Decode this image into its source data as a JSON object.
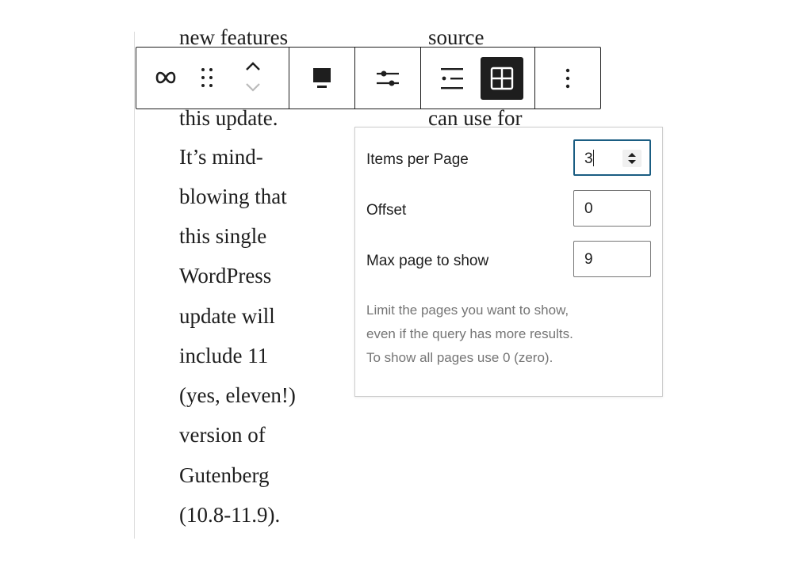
{
  "content": {
    "left_column": [
      "new features",
      "this update.",
      "It’s mind-",
      "blowing that",
      "this single",
      "WordPress",
      "update will",
      "include 11",
      "(yes, eleven!)",
      "version of",
      "Gutenberg",
      "(10.8-11.9)."
    ],
    "right_column": [
      "source",
      "can use for"
    ]
  },
  "toolbar": {
    "buttons": [
      "loop-icon",
      "drag-handle-icon",
      "move-up-icon",
      "move-down-icon",
      "align-icon",
      "settings-sliders-icon",
      "list-view-icon",
      "grid-view-icon",
      "more-options-icon"
    ],
    "active_button": "grid-view-icon",
    "accent": "#1e1e1e"
  },
  "popover": {
    "items_per_page": {
      "label": "Items per Page",
      "value": "3"
    },
    "offset": {
      "label": "Offset",
      "value": "0"
    },
    "max_pages": {
      "label": "Max page to show",
      "value": "9"
    },
    "help": [
      "Limit the pages you want to show,",
      "even if the query has more results.",
      "To show all pages use 0 (zero)."
    ],
    "focus_color": "#1a5d82"
  }
}
